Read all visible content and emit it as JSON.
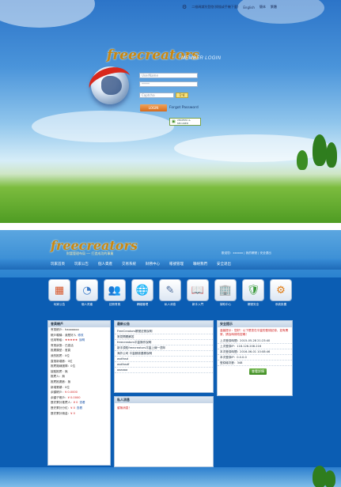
{
  "login": {
    "top_links": [
      "二維碼識別登陸(掃描或手機下載)",
      "English",
      "簡体",
      "繁體"
    ],
    "logo_text": "freecreators",
    "logo_sub": "MEMBER LOGIN",
    "username_placeholder": "UserName",
    "password_placeholder": "*****",
    "captcha_placeholder": "Captcha",
    "captcha_code": "1ᐤ4",
    "login_button": "LOGIN",
    "forgot_label": "Forgot Password",
    "security_badge": "VERIFIED & SECURED"
  },
  "member": {
    "logo_text": "freecreators",
    "logo_tagline": "財富管理布局 ── 打造成功的事業",
    "header_right": "歡迎您：xxxxxx | 我的帳號 | 安全退出",
    "nav": [
      "玩家首頁",
      "玩家公告",
      "個人資產",
      "交易系統",
      "財務中心",
      "帳號管理",
      "聯絡我們",
      "安全退出"
    ],
    "icons": [
      {
        "icon": "blocks-icon",
        "glyph": "▦",
        "label": "玩家公告"
      },
      {
        "icon": "chart-icon",
        "glyph": "◔",
        "label": "個人資產"
      },
      {
        "icon": "people-icon",
        "glyph": "👥",
        "label": "註冊會員"
      },
      {
        "icon": "globe-icon",
        "glyph": "🌐",
        "label": "網絡管理"
      },
      {
        "icon": "pen-icon",
        "glyph": "✎",
        "label": "私人消息"
      },
      {
        "icon": "book-icon",
        "glyph": "📖",
        "label": "新手入門"
      },
      {
        "icon": "building-icon",
        "glyph": "🏢",
        "label": "幫助中心"
      },
      {
        "icon": "shield-icon",
        "glyph": "🛡",
        "label": "帳號安全"
      },
      {
        "icon": "gear-icon",
        "glyph": "⚙",
        "label": "系統設置"
      }
    ],
    "account_panel": {
      "title": "會員帳戶",
      "rows": [
        {
          "k": "會員帳戶：",
          "v": "haoooooo",
          "extra": ""
        },
        {
          "k": "帳戶暱稱：",
          "v": "我是好人",
          "extra": "修改"
        },
        {
          "k": "信用等級：",
          "v": "★★★★★",
          "extra": "說明"
        },
        {
          "k": "會員狀態：",
          "v": "已激活",
          "extra": ""
        },
        {
          "k": "推廣類型：",
          "v": "首頁",
          "extra": ""
        },
        {
          "k": "我的推薦：",
          "v": "0位",
          "extra": ""
        },
        {
          "k": "直推新增數：",
          "v": "0位",
          "extra": ""
        },
        {
          "k": "推薦路線團隊：",
          "v": "0位",
          "extra": ""
        },
        {
          "k": "接點推薦：",
          "v": "無",
          "extra": ""
        },
        {
          "k": "推薦人：",
          "v": "無",
          "extra": ""
        },
        {
          "k": "推薦推廣數：",
          "v": "無",
          "extra": ""
        },
        {
          "k": "新增業績：",
          "v": "0位",
          "extra": ""
        },
        {
          "k": "余額帳戶：",
          "v": "¥ 0.0000",
          "extra": ""
        },
        {
          "k": "余額子帳戶：",
          "v": "¥ 0.0000",
          "extra": ""
        },
        {
          "k": "歷史累計推薦人：",
          "v": "¥ 0",
          "extra": "查看"
        },
        {
          "k": "歷史累計分紅：",
          "v": "¥ 0",
          "extra": "查看"
        },
        {
          "k": "歷史累計佣金：",
          "v": "¥ 0",
          "extra": ""
        }
      ]
    },
    "news_panel": {
      "title": "最新公告",
      "items": [
        "FreeCreators帳號註冊說明",
        "常見問題解答",
        "freecreators平臺操作說明",
        "新手須知freecreators平臺上線一週年",
        "海外公司 平臺數據遷移說明",
        "asdfasd",
        "asdfasdf",
        "aaaaaa"
      ]
    },
    "security_panel": {
      "title": "安全提示",
      "notice": "溫馨提示：您好！以下是您在平臺的登錄記錄，如有異常，請及時修改密碼！",
      "rows": [
        {
          "k": "上次登錄時間：",
          "v": "2015-05-28 21:23:40"
        },
        {
          "k": "上次登錄IP：",
          "v": "118.126.208.216"
        },
        {
          "k": "本次登錄時間：",
          "v": "2016-06-01 10:08:46"
        },
        {
          "k": "本次登錄IP：",
          "v": "0.0.0.0"
        },
        {
          "k": "登錄總次數：",
          "v": "348"
        }
      ],
      "button": "查看詳情"
    },
    "message_panel": {
      "title": "私人消息",
      "text": "暫無消息！"
    }
  }
}
